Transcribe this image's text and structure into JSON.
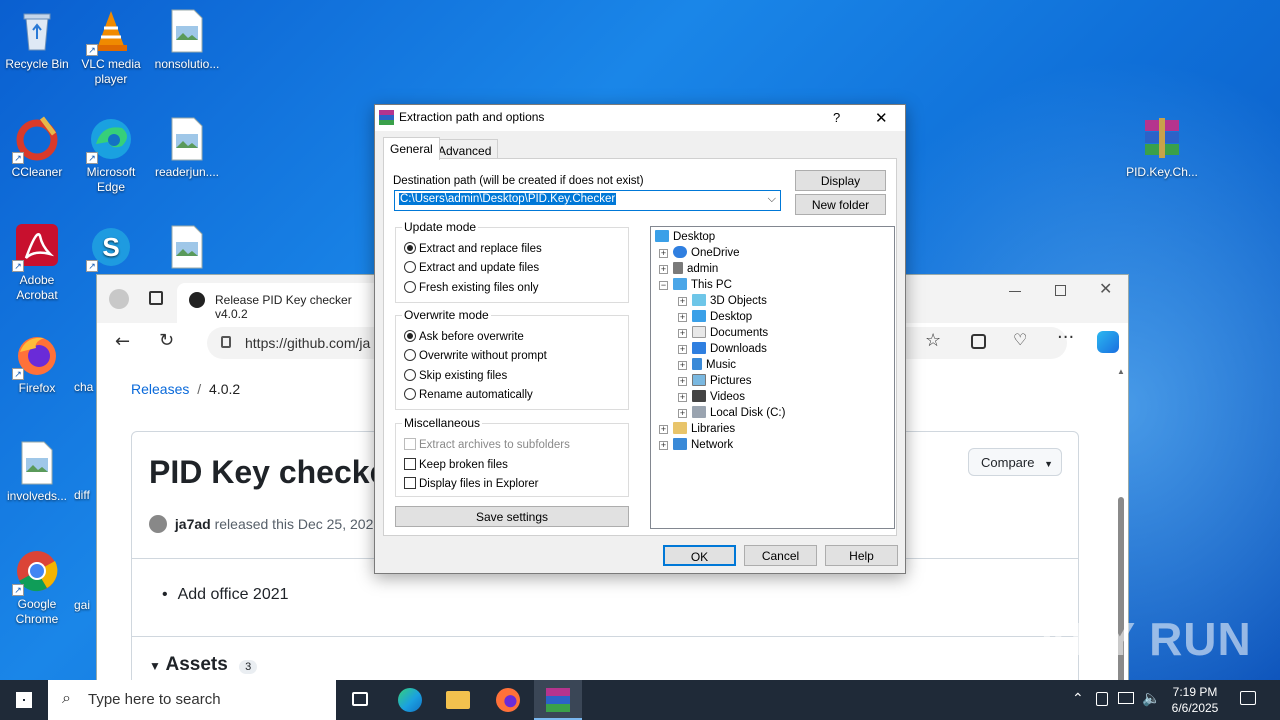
{
  "desktop": {
    "icons": [
      {
        "label": "Recycle Bin"
      },
      {
        "label": "VLC media player"
      },
      {
        "label": "nonsolutio..."
      },
      {
        "label": "CCleaner"
      },
      {
        "label": "Microsoft Edge"
      },
      {
        "label": "readerjun...."
      },
      {
        "label": "Adobe Acrobat"
      },
      {
        "label": "Firefox"
      },
      {
        "label": "cha"
      },
      {
        "label": "involveds..."
      },
      {
        "label": "diff"
      },
      {
        "label": "Google Chrome"
      },
      {
        "label": "gai"
      },
      {
        "label": "PID.Key.Ch..."
      }
    ],
    "watermark": "ANY RUN"
  },
  "browser": {
    "tab_title": "Release PID Key checker v4.0.2",
    "address": "https://github.com/ja",
    "breadcrumb_releases": "Releases",
    "breadcrumb_sep": "/",
    "breadcrumb_version": "4.0.2",
    "release_title": "PID Key checker",
    "author": "ja7ad",
    "released_text": "released this Dec 25, 2021",
    "compare_label": "Compare",
    "notes": [
      "Add office 2021"
    ],
    "assets_label": "Assets",
    "assets_count": "3"
  },
  "dialog": {
    "title": "Extraction path and options",
    "help_glyph": "?",
    "close_glyph": "✕",
    "tabs": [
      "General",
      "Advanced"
    ],
    "dest_label": "Destination path (will be created if does not exist)",
    "dest_value": "C:\\Users\\admin\\Desktop\\PID.Key.Checker",
    "display_btn": "Display",
    "new_folder_btn": "New folder",
    "update_mode": {
      "label": "Update mode",
      "options": [
        "Extract and replace files",
        "Extract and update files",
        "Fresh existing files only"
      ],
      "selected": 0
    },
    "overwrite_mode": {
      "label": "Overwrite mode",
      "options": [
        "Ask before overwrite",
        "Overwrite without prompt",
        "Skip existing files",
        "Rename automatically"
      ],
      "selected": 0
    },
    "misc": {
      "label": "Miscellaneous",
      "options": [
        "Extract archives to subfolders",
        "Keep broken files",
        "Display files in Explorer"
      ]
    },
    "save_settings": "Save settings",
    "tree": [
      "Desktop",
      "OneDrive",
      "admin",
      "This PC",
      "3D Objects",
      "Desktop",
      "Documents",
      "Downloads",
      "Music",
      "Pictures",
      "Videos",
      "Local Disk (C:)",
      "Libraries",
      "Network"
    ],
    "ok": "OK",
    "cancel": "Cancel",
    "help": "Help"
  },
  "taskbar": {
    "search_placeholder": "Type here to search",
    "time": "7:19 PM",
    "date": "6/6/2025"
  }
}
